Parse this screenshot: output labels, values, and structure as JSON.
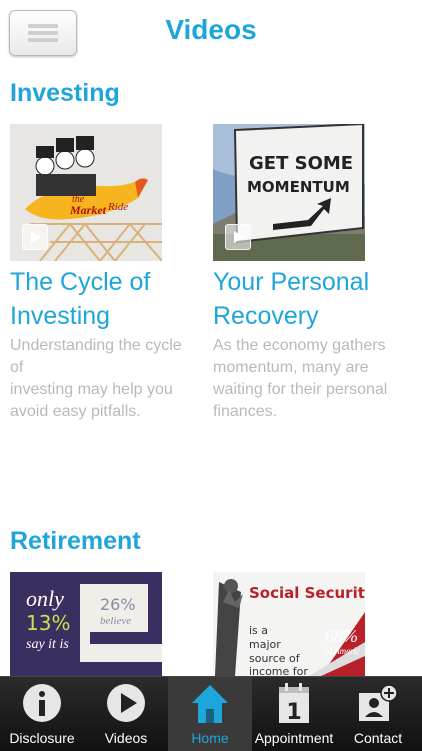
{
  "header": {
    "title": "Videos"
  },
  "sections": [
    {
      "title": "Investing",
      "items": [
        {
          "title_line1": "The Cycle of",
          "title_line2": "Investing",
          "desc_line1": "Understanding the cycle of",
          "desc_line2": "investing may help you",
          "desc_line3": "avoid easy pitfalls.",
          "thumb_text1": "the",
          "thumb_text2": "Market",
          "thumb_text3": "Ride"
        },
        {
          "title_line1": "Your Personal",
          "title_line2": "Recovery",
          "desc_line1": "As the economy gathers",
          "desc_line2": "momentum, many are",
          "desc_line3": "waiting for their personal",
          "desc_line4": "finances.",
          "thumb_text1": "GET SOME",
          "thumb_text2": "MOMENTUM"
        }
      ]
    },
    {
      "title": "Retirement",
      "items": [
        {
          "thumb_text1": "only",
          "thumb_text2": "13%",
          "thumb_text3": "say it is",
          "thumb_text4": "26%",
          "thumb_text5": "believe"
        },
        {
          "thumb_text1": "Social Securit",
          "thumb_text2": "is a",
          "thumb_text3": "major",
          "thumb_text4": "source of",
          "thumb_text5": "income for",
          "thumb_text6": "68%",
          "thumb_text7": "of Americ"
        }
      ]
    }
  ],
  "tabbar": {
    "items": [
      {
        "label": "Disclosure",
        "icon": "info-icon"
      },
      {
        "label": "Videos",
        "icon": "play-icon"
      },
      {
        "label": "Home",
        "icon": "home-icon",
        "active": true
      },
      {
        "label": "Appointment",
        "icon": "calendar-icon"
      },
      {
        "label": "Contact",
        "icon": "contact-add-icon"
      }
    ]
  },
  "colors": {
    "accent": "#1ea6db",
    "description": "#b9b9b9",
    "tabbar": "#1a1a1a"
  }
}
